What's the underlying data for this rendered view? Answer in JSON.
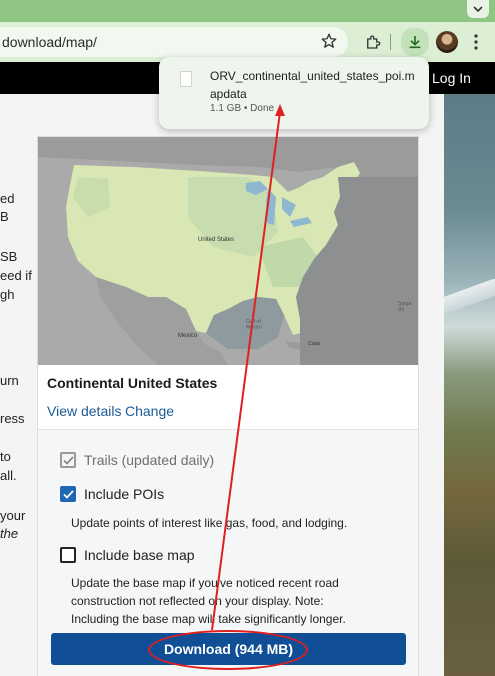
{
  "browser": {
    "url": "download/map/",
    "icons": [
      "chevron-down-icon",
      "star-icon",
      "extensions-icon",
      "download-icon",
      "avatar",
      "more-vert-icon"
    ]
  },
  "site": {
    "login_label": "Log In"
  },
  "left_column_fragments": [
    "ed",
    "B",
    "SB",
    "eed if",
    "gh",
    "urn",
    "ress",
    "to",
    "all.",
    "your",
    "the"
  ],
  "card": {
    "title": "Continental United States",
    "view_details_label": "View details",
    "change_label": "Change",
    "map_labels": {
      "country": "United States",
      "mexico": "Mexico",
      "gulf": "Gulf of\nMexico",
      "cuba": "Cuba",
      "sargasso": "Sarga\nSe"
    },
    "options": {
      "trails_label": "Trails (updated daily)",
      "trails_checked": true,
      "trails_disabled": true,
      "pois_label": "Include POIs",
      "pois_checked": true,
      "pois_help": "Update points of interest like gas, food, and lodging.",
      "basemap_label": "Include base map",
      "basemap_checked": false,
      "basemap_help": "Update the base map if you've noticed recent road construction not reflected on your display. Note: Including the base map will take significantly longer."
    },
    "download_label": "Download (944 MB)"
  },
  "download_bubble": {
    "file_name": "ORV_continental_united_states_poi.mapdata",
    "status": "1.1 GB • Done"
  },
  "colors": {
    "accent": "#104f95",
    "annotation": "#e02020",
    "header": "#000000"
  }
}
